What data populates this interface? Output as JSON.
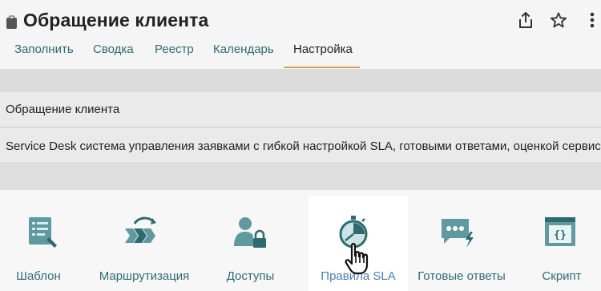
{
  "header": {
    "title": "Обращение клиента",
    "icons": {
      "app": "clipboard-icon",
      "share": "share-icon",
      "star": "star-icon",
      "more": "more-vertical-icon"
    }
  },
  "tabs": [
    {
      "label": "Заполнить",
      "active": false
    },
    {
      "label": "Сводка",
      "active": false
    },
    {
      "label": "Реестр",
      "active": false
    },
    {
      "label": "Календарь",
      "active": false
    },
    {
      "label": "Настройка",
      "active": true
    }
  ],
  "details": {
    "name": "Обращение клиента",
    "description": "Service Desk система управления заявками с гибкой настройкой SLA, готовыми ответами, оценкой сервиса"
  },
  "actions": [
    {
      "label": "Шаблон",
      "icon": "template-icon"
    },
    {
      "label": "Маршрутизация",
      "icon": "routing-icon"
    },
    {
      "label": "Доступы",
      "icon": "access-icon"
    },
    {
      "label": "Правила SLA",
      "icon": "timer-icon",
      "highlighted": true
    },
    {
      "label": "Готовые ответы",
      "icon": "canned-replies-icon"
    },
    {
      "label": "Скрипт",
      "icon": "script-icon"
    }
  ],
  "colors": {
    "accent": "#2e6b73",
    "tab_underline": "#d9a45a",
    "icon_teal": "#3d7a80"
  }
}
